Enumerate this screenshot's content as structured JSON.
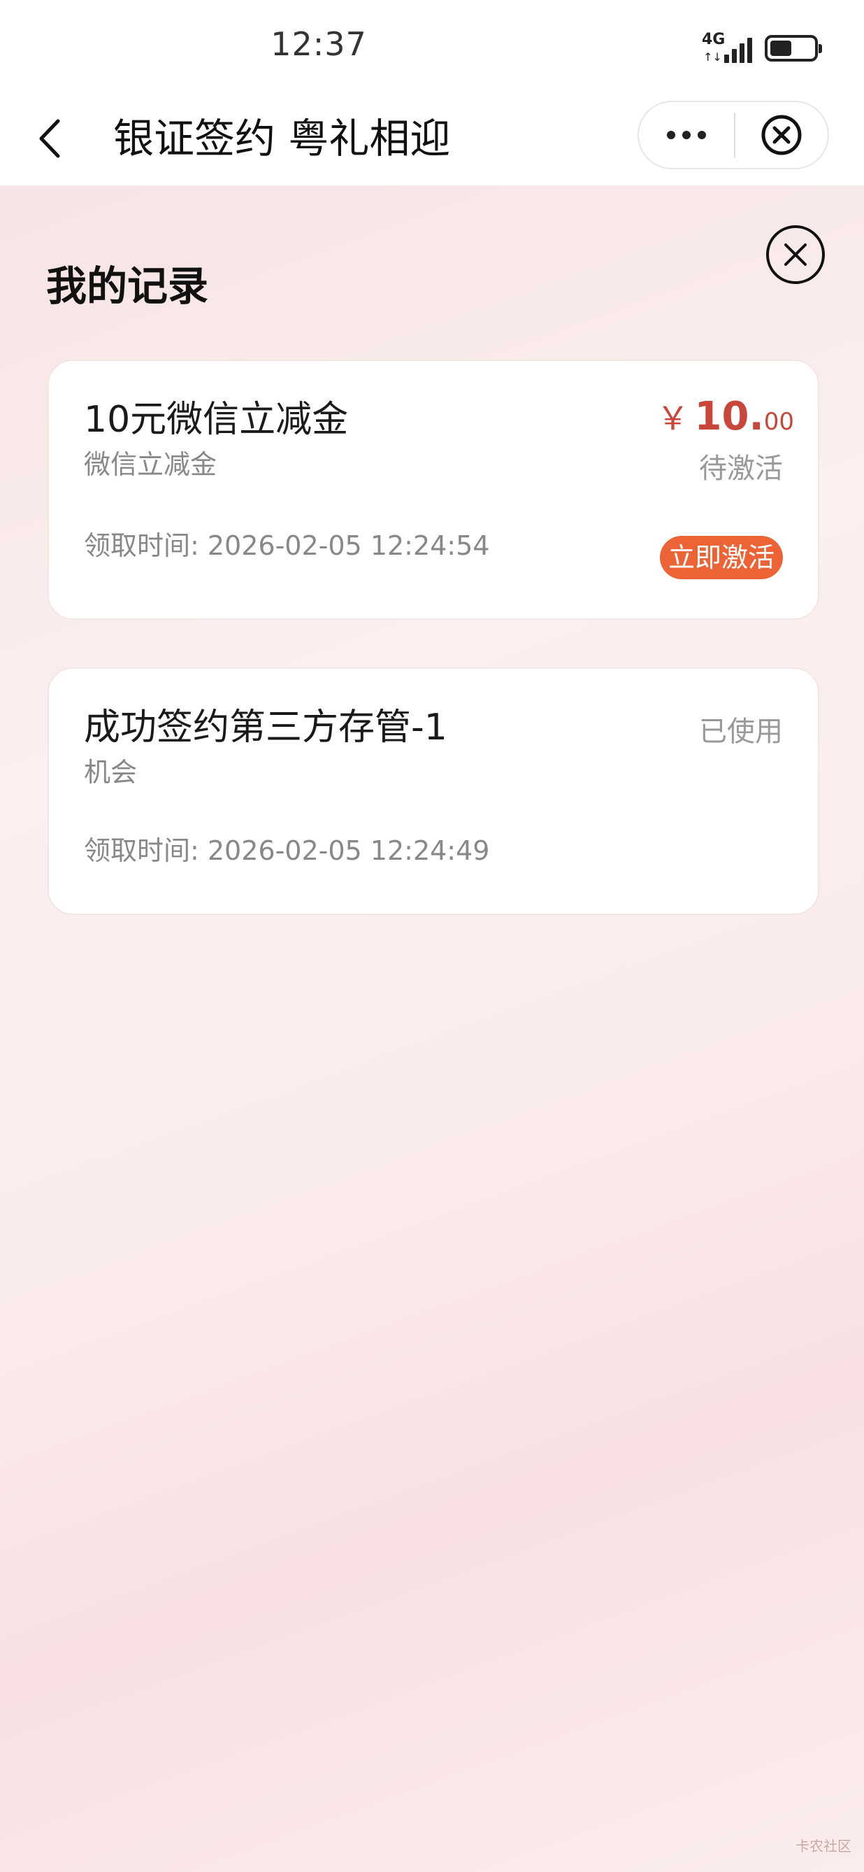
{
  "status_bar": {
    "time": "12:37",
    "network": "4G",
    "network_arrows": "↑↓",
    "battery_level": 0.5
  },
  "nav": {
    "back_icon": "chevron-left-icon",
    "title": "银证签约 粤礼相迎",
    "more_icon": "more-dots-icon",
    "close_icon": "close-circle-icon"
  },
  "panel": {
    "title": "我的记录",
    "close_icon": "close-circle-icon"
  },
  "records": [
    {
      "name": "10元微信立减金",
      "subtitle": "微信立减金",
      "time": "领取时间: 2026-02-05 12:24:54",
      "currency": "￥",
      "amount_int": "10.",
      "amount_dec": "00",
      "status": "待激活",
      "action_label": "立即激活"
    },
    {
      "name": "成功签约第三方存管-1",
      "subtitle": "机会",
      "time": "领取时间: 2026-02-05 12:24:49",
      "status": "已使用"
    }
  ],
  "watermark": "卡农社区",
  "colors": {
    "accent": "#ec6435",
    "amount": "#c8463a"
  }
}
